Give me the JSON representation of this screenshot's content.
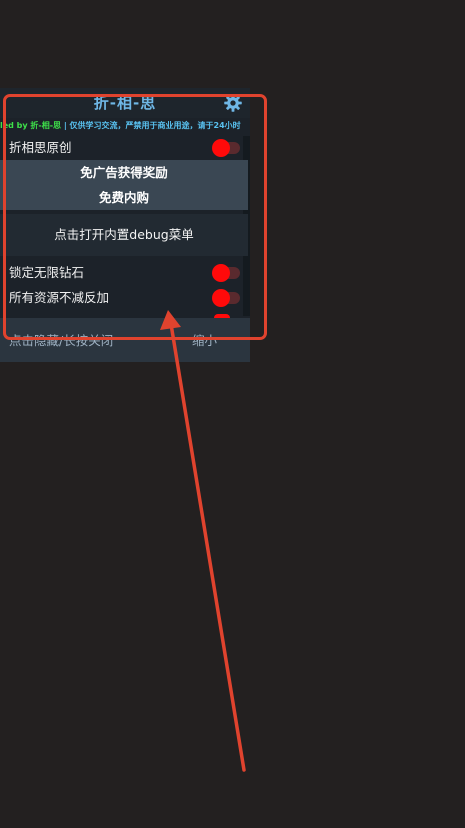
{
  "menu": {
    "title": "折-相-思",
    "marquee_credit": "led by 折-相-思",
    "marquee_notice": " | 仅供学习交流，严禁用于商业用途，请于24小时",
    "toggles": [
      {
        "label": "折相思原创",
        "on": true
      },
      {
        "label": "锁定无限钻石",
        "on": true
      },
      {
        "label": "所有资源不减反加",
        "on": true
      }
    ],
    "reward_button": "免广告获得奖励",
    "purchase_button": "免费内购",
    "debug_button": "点击打开内置debug菜单",
    "footer": {
      "hide_label": "点击隐藏/长按关闭",
      "minimize_label": "缩小"
    }
  },
  "annotation": {
    "box_color": "#e0432e",
    "arrow_color": "#e0432e"
  },
  "colors": {
    "background": "#232020",
    "panel": "#1c2229",
    "title": "#6fb7e6",
    "credit": "#3ee14a",
    "notice": "#59c2f0",
    "switch_on": "#ff0a0a"
  }
}
